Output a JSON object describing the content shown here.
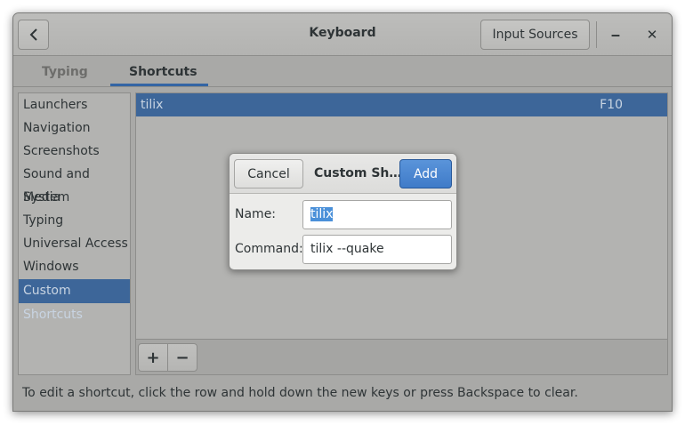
{
  "window": {
    "title": "Keyboard"
  },
  "header": {
    "back_icon": "chevron-left-icon",
    "input_sources_label": "Input Sources",
    "minimize_glyph": "‒",
    "close_glyph": "✕"
  },
  "tabs": [
    {
      "label": "Typing",
      "active": false
    },
    {
      "label": "Shortcuts",
      "active": true
    }
  ],
  "sidebar": {
    "items": [
      {
        "label": "Launchers"
      },
      {
        "label": "Navigation"
      },
      {
        "label": "Screenshots"
      },
      {
        "label": "Sound and Media"
      },
      {
        "label": "System"
      },
      {
        "label": "Typing"
      },
      {
        "label": "Universal Access"
      },
      {
        "label": "Windows"
      },
      {
        "label": "Custom Shortcuts",
        "selected": true
      }
    ]
  },
  "shortcuts_list": {
    "rows": [
      {
        "name": "tilix",
        "accel": "F10",
        "selected": true
      }
    ],
    "add_label": "+",
    "remove_label": "−"
  },
  "footer": {
    "hint": "To edit a shortcut, click the row and hold down the new keys or press Backspace to clear."
  },
  "dialog": {
    "cancel_label": "Cancel",
    "title": "Custom Sh…",
    "add_label": "Add",
    "name_label": "Name:",
    "name_value": "tilix",
    "command_label": "Command:",
    "command_value": "tilix --quake"
  },
  "colors": {
    "selection": "#3d6699",
    "accent": "#4a90d9",
    "tab_underline": "#3465a4"
  }
}
